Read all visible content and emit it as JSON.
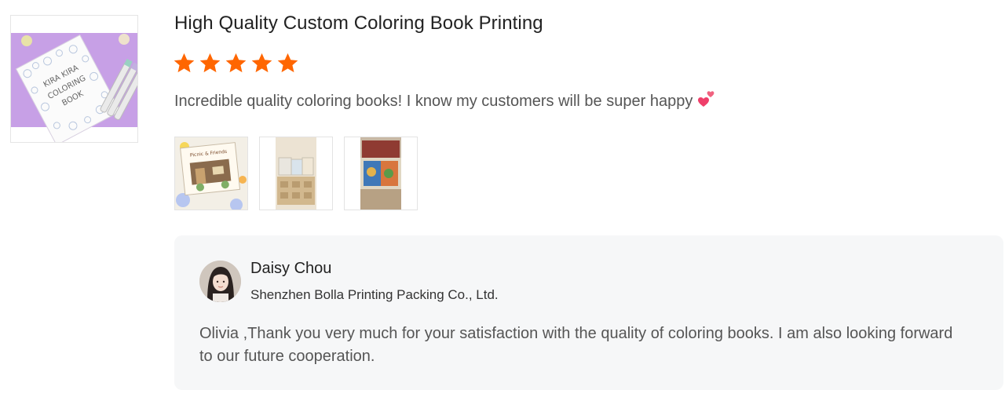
{
  "review": {
    "title": "High Quality Custom Coloring Book Printing",
    "rating": 5,
    "rating_max": 5,
    "star_icon": "star-icon",
    "star_color": "#ff6600",
    "text": "Incredible quality coloring books! I know my customers will be super happy",
    "emoji_icon": "two-hearts-icon",
    "product_image": {
      "icon": "coloring-book-image",
      "cover_text_line1": "KIRA KIRA",
      "cover_text_line2": "COLORING",
      "cover_text_line3": "BOOK"
    },
    "photos": [
      {
        "name": "review-photo-1",
        "cover_text": "Picnic & Friends"
      },
      {
        "name": "review-photo-2"
      },
      {
        "name": "review-photo-3"
      }
    ]
  },
  "reply": {
    "name": "Daisy Chou",
    "company": "Shenzhen Bolla Printing Packing Co., Ltd.",
    "text": "Olivia ,Thank you very much for your satisfaction with the quality of coloring books. I am also looking forward to our future cooperation.",
    "background": "#f6f7f8"
  }
}
